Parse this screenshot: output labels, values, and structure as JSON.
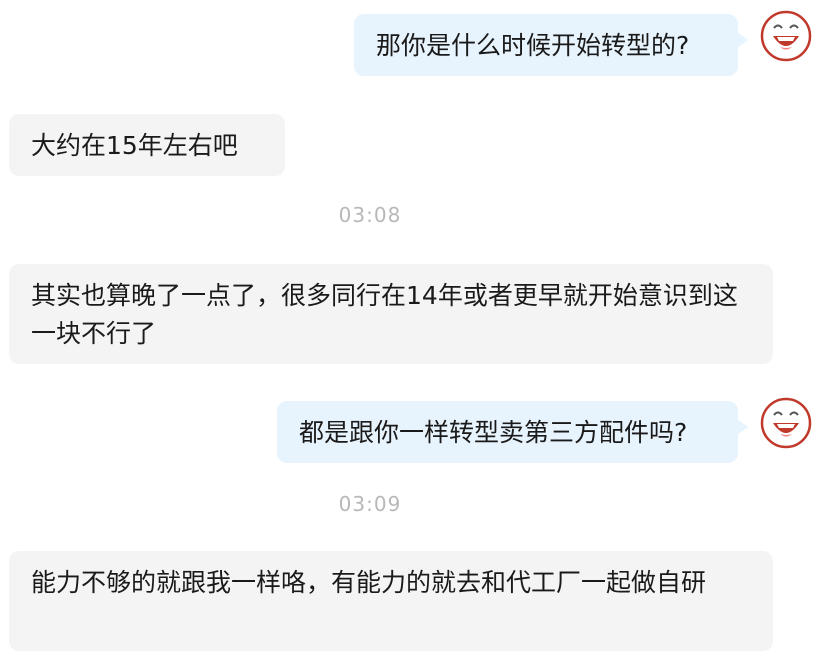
{
  "messages": [
    {
      "id": "m1",
      "side": "out",
      "text": "那你是什么时候开始转型的?"
    },
    {
      "id": "m2",
      "side": "in",
      "text": "大约在15年左右吧"
    },
    {
      "id": "m3",
      "side": "in",
      "text": "其实也算晚了一点了，很多同行在14年或者更早就开始意识到这一块不行了"
    },
    {
      "id": "m4",
      "side": "out",
      "text": "都是跟你一样转型卖第三方配件吗?"
    },
    {
      "id": "m5",
      "side": "in",
      "text": "能力不够的就跟我一样咯，有能力的就去和代工厂一起做自研"
    }
  ],
  "timestamps": {
    "t1": "03:08",
    "t2": "03:09"
  },
  "avatar_icon": "laughing-face-icon"
}
